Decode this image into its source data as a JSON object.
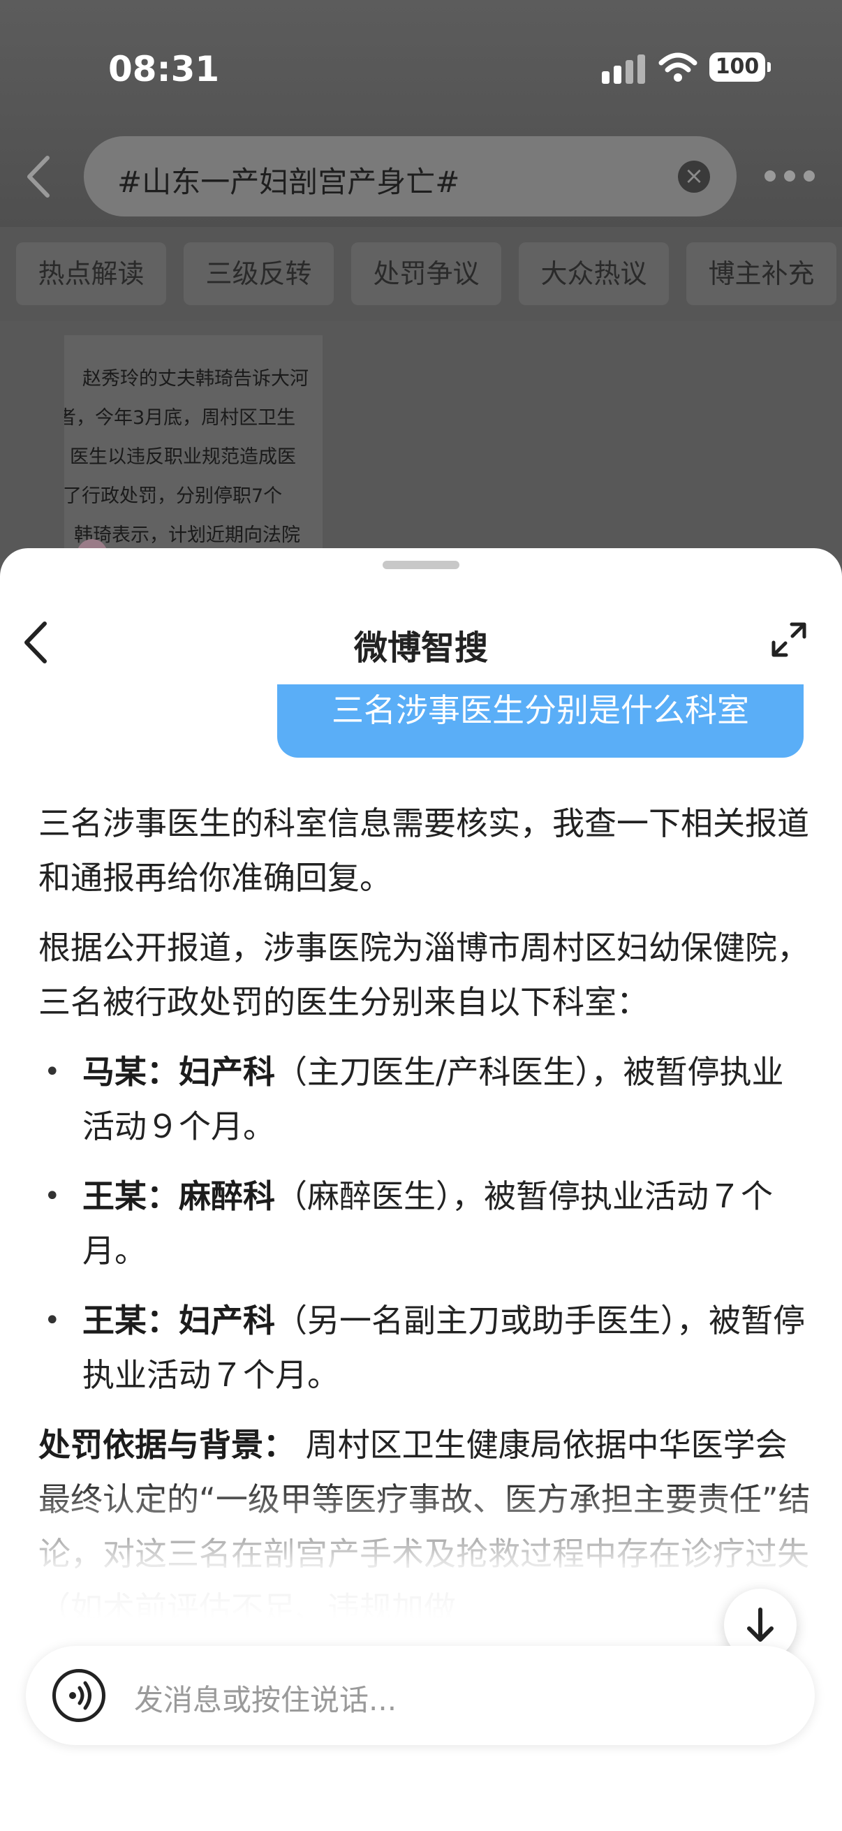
{
  "status_bar": {
    "time": "08:31",
    "battery": "100",
    "icons": [
      "signal-icon",
      "wifi-icon",
      "battery-icon"
    ]
  },
  "search": {
    "query": "#山东一产妇剖宫产身亡#",
    "clear_icon": "clear-icon"
  },
  "tabs": [
    {
      "label": "热点解读"
    },
    {
      "label": "三级反转"
    },
    {
      "label": "处罚争议"
    },
    {
      "label": "大众热议"
    },
    {
      "label": "博主补充"
    }
  ],
  "background_card": {
    "lines": [
      "赵秀玲的丈夫韩琦告诉大河",
      "者，今年3月底，周村区卫生",
      "医生以违反职业规范造成医",
      "了行政处罚，分别停职7个",
      "韩琦表示，计划近期向法院"
    ]
  },
  "sheet": {
    "title": "微博智搜",
    "user_message": "三名涉事医生分别是什么科室",
    "answer": {
      "para1": "三名涉事医生的科室信息需要核实，我查一下相关报道和通报再给你准确回复。",
      "para2": "根据公开报道，涉事医院为淄博市周村区妇幼保健院，三名被行政处罚的医生分别来自以下科室：",
      "items": [
        {
          "name": "马某：",
          "dept": "妇产科",
          "detail": "（主刀医生/产科医生），被暂停执业活动９个月。"
        },
        {
          "name": "王某：",
          "dept": "麻醉科",
          "detail": "（麻醉医生），被暂停执业活动７个月。"
        },
        {
          "name": "王某：",
          "dept": "妇产科",
          "detail": "（另一名副主刀或助手医生），被暂停执业活动７个月。"
        }
      ],
      "para3_bold": "处罚依据与背景：",
      "para3": " 周村区卫生健康局依据中华医学会最终认定的“一级甲等医疗事故、医方承担主要责任”结论，对这三名在剖宫产手术及抢救过程中存在诊疗过失（如术前评估不足、违规加做"
    },
    "input_placeholder": "发消息或按住说话..."
  }
}
